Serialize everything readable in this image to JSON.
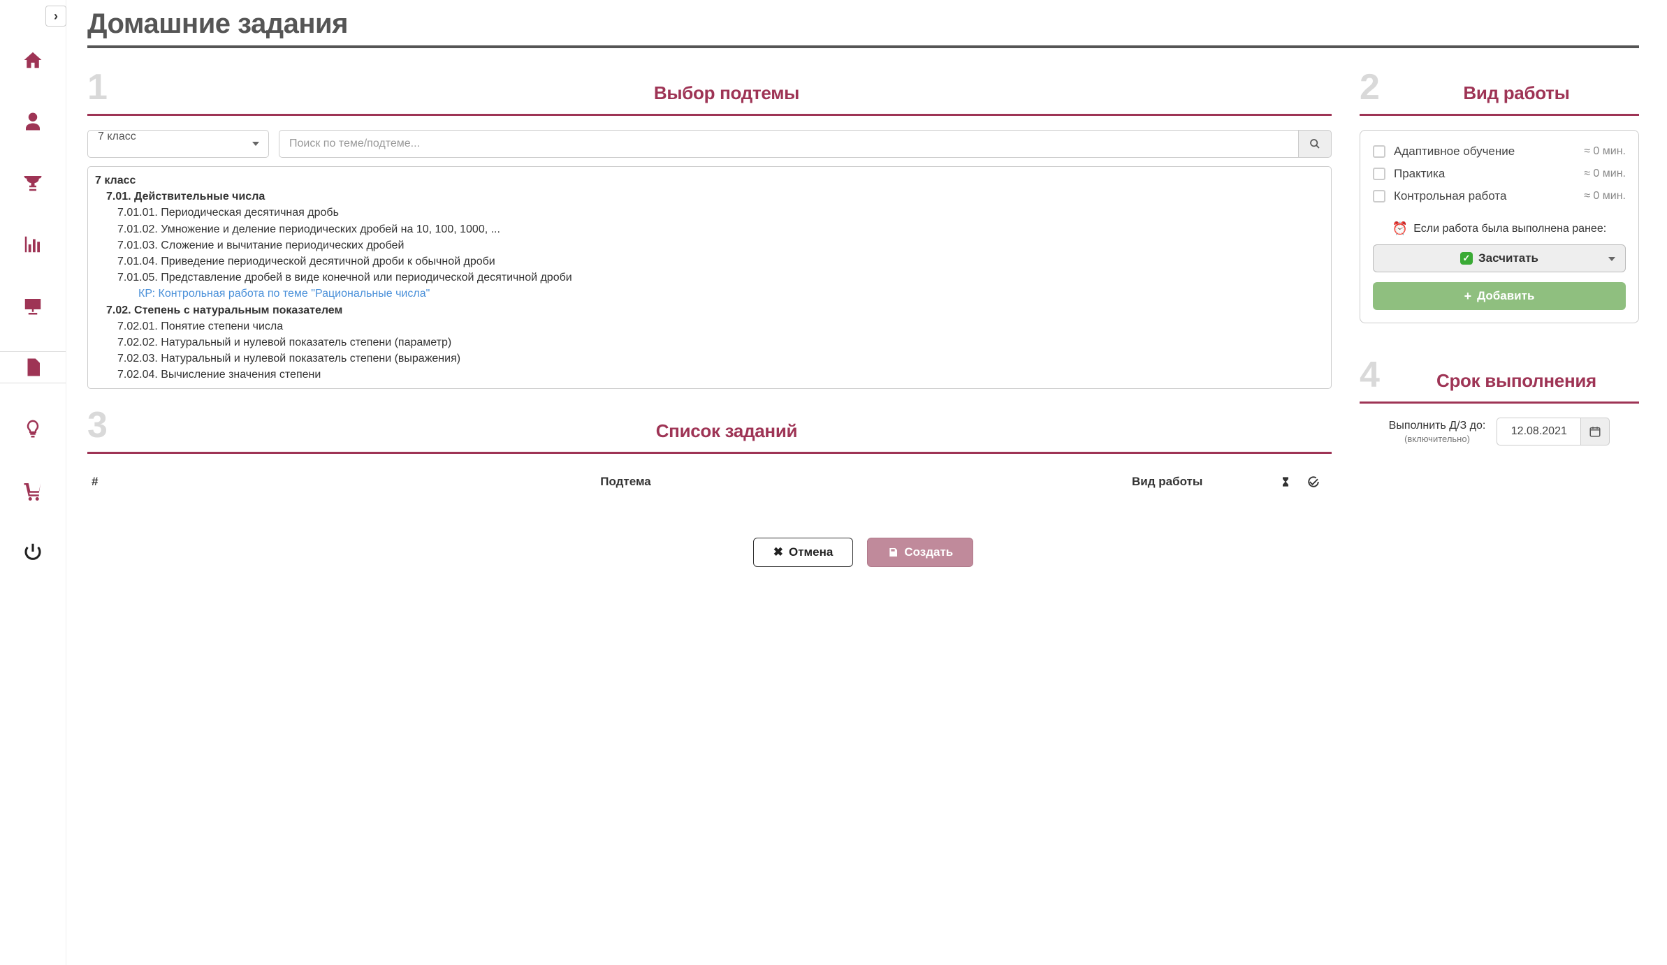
{
  "page_title": "Домашние задания",
  "sections": {
    "s1": {
      "num": "1",
      "title": "Выбор подтемы"
    },
    "s2": {
      "num": "2",
      "title": "Вид работы"
    },
    "s3": {
      "num": "3",
      "title": "Список заданий"
    },
    "s4": {
      "num": "4",
      "title": "Срок выполнения"
    }
  },
  "class_select": "7 класс",
  "search_placeholder": "Поиск по теме/подтеме...",
  "tree": {
    "root": "7 класс",
    "topic1": "7.01. Действительные числа",
    "s1": "7.01.01. Периодическая десятичная дробь",
    "s2": "7.01.02. Умножение и деление периодических дробей на 10, 100, 1000, ...",
    "s3": "7.01.03. Сложение и вычитание периодических дробей",
    "s4": "7.01.04. Приведение периодической десятичной дроби к обычной дроби",
    "s5": "7.01.05. Представление дробей в виде конечной или периодической десятичной дроби",
    "kp1": "КР: Контрольная работа по теме \"Рациональные числа\"",
    "topic2": "7.02. Степень с натуральным показателем",
    "s6": "7.02.01. Понятие степени числа",
    "s7": "7.02.02. Натуральный и нулевой показатель степени (параметр)",
    "s8": "7.02.03. Натуральный и нулевой показатель степени (выражения)",
    "s9": "7.02.04. Вычисление значения степени"
  },
  "work_types": {
    "adaptive": {
      "label": "Адаптивное обучение",
      "mins": "≈ 0 мин."
    },
    "practice": {
      "label": "Практика",
      "mins": "≈ 0 мин."
    },
    "test": {
      "label": "Контрольная работа",
      "mins": "≈ 0 мин."
    }
  },
  "prior_msg": "Если работа была выполнена ранее:",
  "count_select": "Засчитать",
  "add_btn": "Добавить",
  "task_table": {
    "col_num": "#",
    "col_sub": "Подтема",
    "col_type": "Вид работы"
  },
  "due": {
    "label": "Выполнить Д/З до:",
    "hint": "(включительно)",
    "value": "12.08.2021"
  },
  "actions": {
    "cancel": "Отмена",
    "create": "Создать"
  }
}
